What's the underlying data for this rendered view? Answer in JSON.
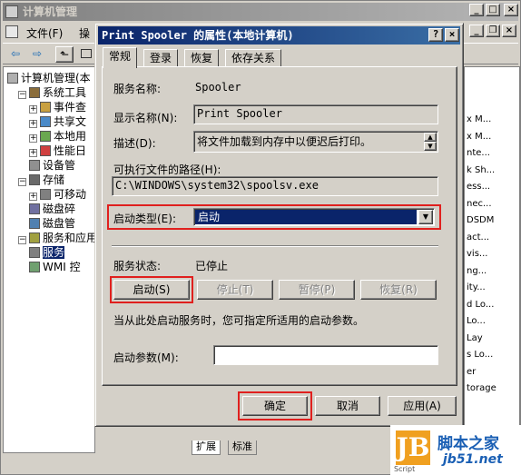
{
  "main_window": {
    "title": "计算机管理",
    "caption_buttons": {
      "minimize": "_",
      "maximize": "□",
      "close": "×"
    },
    "menu": {
      "file": "文件(F)",
      "action": "操"
    },
    "inner_caption": {
      "minimize": "_",
      "restore": "❐",
      "close": "×"
    },
    "toolbar": {
      "back": "⇦",
      "forward": "⇨",
      "up": "⬑"
    },
    "tree": [
      {
        "label": "计算机管理(本",
        "indent": 0,
        "expander": ""
      },
      {
        "label": "系统工具",
        "indent": 1,
        "expander": "−"
      },
      {
        "label": "事件查",
        "indent": 2,
        "expander": "+"
      },
      {
        "label": "共享文",
        "indent": 2,
        "expander": "+"
      },
      {
        "label": "本地用",
        "indent": 2,
        "expander": "+"
      },
      {
        "label": "性能日",
        "indent": 2,
        "expander": "+"
      },
      {
        "label": "设备管",
        "indent": 2,
        "expander": ""
      },
      {
        "label": "存储",
        "indent": 1,
        "expander": "−"
      },
      {
        "label": "可移动",
        "indent": 2,
        "expander": "+"
      },
      {
        "label": "磁盘碎",
        "indent": 2,
        "expander": ""
      },
      {
        "label": "磁盘管",
        "indent": 2,
        "expander": ""
      },
      {
        "label": "服务和应用",
        "indent": 1,
        "expander": "−"
      },
      {
        "label": "服务",
        "indent": 2,
        "expander": "",
        "selected": true
      },
      {
        "label": "WMI 控",
        "indent": 2,
        "expander": ""
      }
    ],
    "right_list": [
      "x M...",
      "x M...",
      "nte...",
      "k Sh...",
      "ess...",
      "nec...",
      "DSDM",
      "act...",
      "vis...",
      "ng...",
      "ity...",
      "d Lo...",
      "Lo...",
      "Lay",
      "s Lo...",
      "er",
      "torage"
    ],
    "bottom_tabs": {
      "extended": "扩展",
      "standard": "标准"
    }
  },
  "dialog": {
    "title": "Print Spooler 的属性(本地计算机)",
    "caption_buttons": {
      "help": "?",
      "close": "×"
    },
    "tabs": [
      "常规",
      "登录",
      "恢复",
      "依存关系"
    ],
    "service_name_label": "服务名称:",
    "service_name_value": "Spooler",
    "display_name_label": "显示名称(N):",
    "display_name_value": "Print Spooler",
    "description_label": "描述(D):",
    "description_value": "将文件加载到内存中以便迟后打印。",
    "exe_path_label": "可执行文件的路径(H):",
    "exe_path_value": "C:\\WINDOWS\\system32\\spoolsv.exe",
    "startup_type_label": "启动类型(E):",
    "startup_type_value": "启动",
    "service_status_label": "服务状态:",
    "service_status_value": "已停止",
    "buttons": {
      "start": "启动(S)",
      "stop": "停止(T)",
      "pause": "暂停(P)",
      "resume": "恢复(R)"
    },
    "hint": "当从此处启动服务时，您可指定所适用的启动参数。",
    "start_params_label": "启动参数(M):",
    "start_params_value": "",
    "footer": {
      "ok": "确定",
      "cancel": "取消",
      "apply": "应用(A)"
    }
  },
  "watermark": {
    "logo": "JB",
    "cn": "脚本之家",
    "url": "jb51.net",
    "script": "Script"
  },
  "colors": {
    "highlight_red": "#e0201e",
    "title_active": "#0a246a",
    "selection": "#0a246a"
  }
}
